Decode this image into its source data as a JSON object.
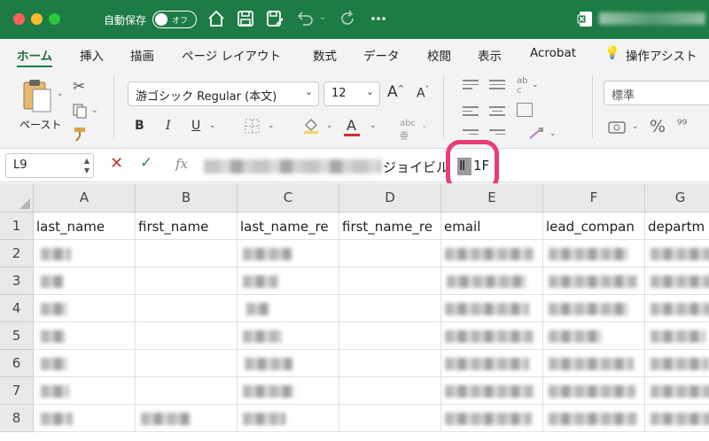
{
  "titlebar": {
    "autosave_label": "自動保存",
    "autosave_state": "オフ",
    "icons": [
      "home-icon",
      "save-icon",
      "save-as-icon",
      "undo-icon",
      "redo-icon",
      "more-icon"
    ]
  },
  "tabs": [
    "ホーム",
    "挿入",
    "描画",
    "ページ レイアウト",
    "数式",
    "データ",
    "校閲",
    "表示",
    "Acrobat",
    "操作アシスト"
  ],
  "ribbon": {
    "paste_label": "ペースト",
    "font_name": "游ゴシック Regular (本文)",
    "font_size": "12",
    "bold": "B",
    "italic": "I",
    "underline": "U",
    "grow_font": "A",
    "shrink_font": "A",
    "font_color": "A",
    "number_format": "標準",
    "percent": "%"
  },
  "formula_bar": {
    "cell_ref": "L9",
    "cancel_symbol": "✕",
    "enter_symbol": "✓",
    "fx_label": "fx",
    "visible_text": "ジョイビル",
    "cursor_char": "Ⅱ",
    "tail_text": "1F"
  },
  "grid": {
    "columns": [
      "A",
      "B",
      "C",
      "D",
      "E",
      "F",
      "G"
    ],
    "rows": [
      "1",
      "2",
      "3",
      "4",
      "5",
      "6",
      "7",
      "8"
    ],
    "headers": [
      "last_name",
      "first_name",
      "last_name_re",
      "first_name_re",
      "email",
      "lead_compan",
      "departm"
    ]
  }
}
